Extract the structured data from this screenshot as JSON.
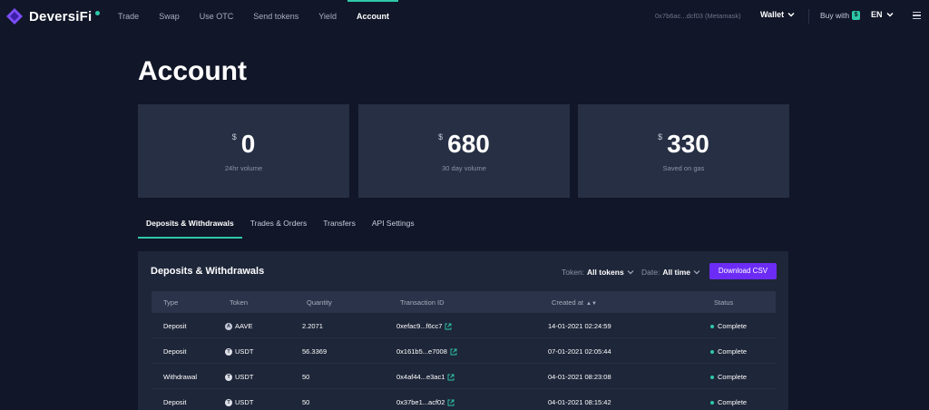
{
  "brand": {
    "name": "DeversiFi"
  },
  "nav": {
    "links": [
      "Trade",
      "Swap",
      "Use OTC",
      "Send tokens",
      "Yield",
      "Account"
    ],
    "active": "Account",
    "wallet_address": "0x7b6ac...dcf03 (Metamask)",
    "wallet_label": "Wallet",
    "buy_with_label": "Buy with",
    "language": "EN"
  },
  "page": {
    "title": "Account"
  },
  "stats": [
    {
      "currency": "$",
      "value": "0",
      "label": "24hr volume"
    },
    {
      "currency": "$",
      "value": "680",
      "label": "30 day volume"
    },
    {
      "currency": "$",
      "value": "330",
      "label": "Saved on gas"
    }
  ],
  "tabs": [
    {
      "label": "Deposits & Withdrawals",
      "active": true
    },
    {
      "label": "Trades & Orders",
      "active": false
    },
    {
      "label": "Transfers",
      "active": false
    },
    {
      "label": "API Settings",
      "active": false
    }
  ],
  "panel": {
    "title": "Deposits & Withdrawals",
    "token_filter_label": "Token:",
    "token_filter_value": "All tokens",
    "date_filter_label": "Date:",
    "date_filter_value": "All time",
    "download_label": "Download CSV"
  },
  "table": {
    "headers": [
      "Type",
      "Token",
      "Quantity",
      "Transaction ID",
      "Created at",
      "Status"
    ],
    "rows": [
      {
        "type": "Deposit",
        "token": "AAVE",
        "quantity": "2.2071",
        "tx": "0xefac9...f6cc7",
        "created": "14-01-2021 02:24:59",
        "status": "Complete"
      },
      {
        "type": "Deposit",
        "token": "USDT",
        "quantity": "56.3369",
        "tx": "0x161b5...e7008",
        "created": "07-01-2021 02:05:44",
        "status": "Complete"
      },
      {
        "type": "Withdrawal",
        "token": "USDT",
        "quantity": "50",
        "tx": "0x4af44...e3ac1",
        "created": "04-01-2021 08:23:08",
        "status": "Complete"
      },
      {
        "type": "Deposit",
        "token": "USDT",
        "quantity": "50",
        "tx": "0x37be1...acf02",
        "created": "04-01-2021 08:15:42",
        "status": "Complete"
      }
    ]
  },
  "colors": {
    "accent": "#2ec8a8",
    "button": "#6c2cf5",
    "background": "#111628",
    "card": "#262f44"
  }
}
